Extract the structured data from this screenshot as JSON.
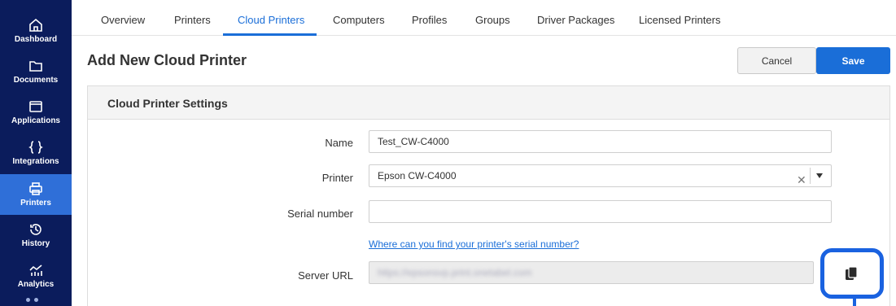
{
  "sidebar": {
    "items": [
      {
        "label": "Dashboard",
        "icon": "home-icon"
      },
      {
        "label": "Documents",
        "icon": "folder-icon"
      },
      {
        "label": "Applications",
        "icon": "window-icon"
      },
      {
        "label": "Integrations",
        "icon": "braces-icon"
      },
      {
        "label": "Printers",
        "icon": "printer-icon",
        "active": true
      },
      {
        "label": "History",
        "icon": "history-icon"
      },
      {
        "label": "Analytics",
        "icon": "analytics-icon"
      }
    ],
    "colors": {
      "background": "#0b1c5c",
      "active": "#2f6fd8"
    }
  },
  "tabs": [
    {
      "label": "Overview"
    },
    {
      "label": "Printers"
    },
    {
      "label": "Cloud Printers",
      "active": true
    },
    {
      "label": "Computers"
    },
    {
      "label": "Profiles"
    },
    {
      "label": "Groups"
    },
    {
      "label": "Driver Packages"
    },
    {
      "label": "Licensed Printers"
    }
  ],
  "header": {
    "title": "Add New Cloud Printer",
    "cancel_label": "Cancel",
    "save_label": "Save"
  },
  "card": {
    "title": "Cloud Printer Settings",
    "fields": {
      "name": {
        "label": "Name",
        "value": "Test_CW-C4000"
      },
      "printer": {
        "label": "Printer",
        "value": "Epson CW-C4000"
      },
      "serial": {
        "label": "Serial number",
        "value": ""
      },
      "help_link": "Where can you find your printer's serial number?",
      "server_url": {
        "label": "Server URL",
        "value": "https://epsonsvp.print.onetabel.com"
      }
    }
  },
  "accent_color": "#1a6ed8"
}
